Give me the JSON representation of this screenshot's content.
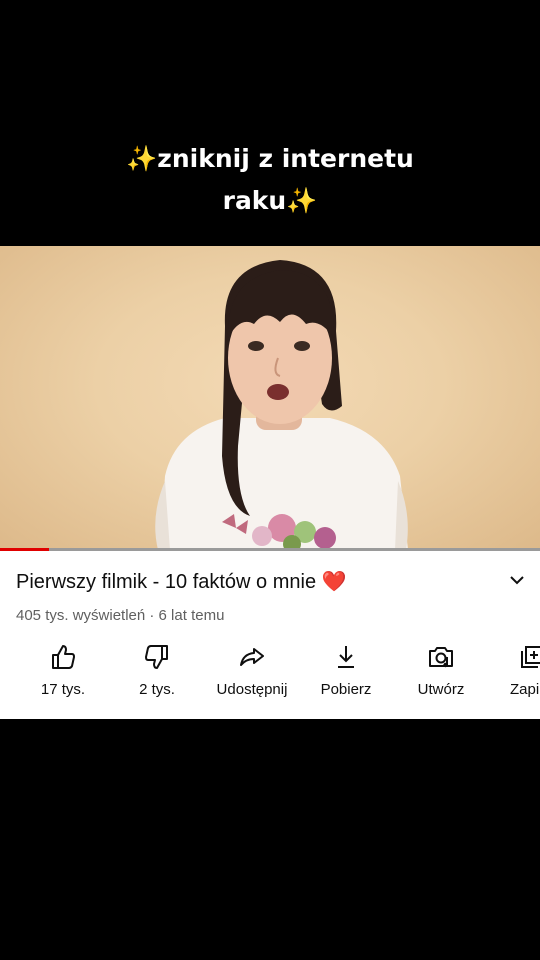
{
  "overlay": {
    "line1": "zniknij z internetu",
    "line2": "raku",
    "sparkle": "✨"
  },
  "video": {
    "progress_fraction": 0.09,
    "accent_color": "#e00000"
  },
  "info": {
    "title": "Pierwszy filmik - 10 faktów o mnie",
    "title_emoji": "❤️",
    "meta": "405 tys. wyświetleń · 6 lat temu"
  },
  "actions": [
    {
      "label": "17 tys.",
      "icon": "thumbs-up-icon"
    },
    {
      "label": "2 tys.",
      "icon": "thumbs-down-icon"
    },
    {
      "label": "Udostępnij",
      "icon": "share-icon"
    },
    {
      "label": "Pobierz",
      "icon": "download-icon"
    },
    {
      "label": "Utwórz",
      "icon": "remix-camera-icon"
    },
    {
      "label": "Zapi",
      "icon": "save-playlist-icon"
    }
  ]
}
